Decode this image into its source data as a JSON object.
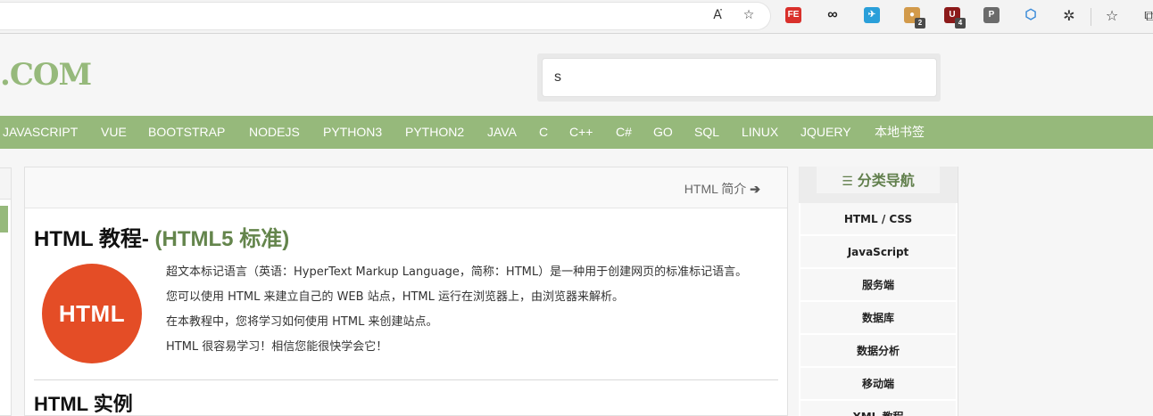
{
  "browser": {
    "read_aloud_icon": "read-aloud-icon",
    "favorite_icon": "add-favorite-icon",
    "extensions": [
      {
        "name": "fe-extension-icon",
        "label": "FE",
        "color": "#d9302b"
      },
      {
        "name": "infinity-extension-icon",
        "label": "∞",
        "color": "#222222"
      },
      {
        "name": "telegram-extension-icon",
        "label": "✈",
        "color": "#2a9fd9"
      },
      {
        "name": "cookie-extension-icon",
        "label": "●",
        "color": "#d29a4a",
        "badge": "2"
      },
      {
        "name": "ublock-extension-icon",
        "label": "U",
        "color": "#8c1a1a",
        "badge": "4"
      },
      {
        "name": "p-extension-icon",
        "label": "P",
        "color": "#6b6b6b"
      },
      {
        "name": "puzzle-blue-extension-icon",
        "label": "⬡",
        "color": "#3b8bd9"
      }
    ]
  },
  "header": {
    "logo_text": ".COM",
    "search_value": "s"
  },
  "nav": {
    "items": [
      "JAVASCRIPT",
      "VUE",
      "BOOTSTRAP",
      "NODEJS",
      "PYTHON3",
      "PYTHON2",
      "JAVA",
      "C",
      "C++",
      "C#",
      "GO",
      "SQL",
      "LINUX",
      "JQUERY",
      "本地书签"
    ]
  },
  "main": {
    "next_link": "HTML 简介",
    "title_prefix": "HTML 教程- ",
    "title_accent": "(HTML5 标准)",
    "logo_text": "HTML",
    "paragraphs": [
      "超文本标记语言（英语：HyperText Markup Language，简称：HTML）是一种用于创建网页的标准标记语言。",
      "您可以使用 HTML 来建立自己的 WEB 站点，HTML 运行在浏览器上，由浏览器来解析。",
      "在本教程中，您将学习如何使用 HTML 来创建站点。",
      "HTML 很容易学习！相信您能很快学会它！"
    ],
    "section_title": "HTML 实例"
  },
  "sidebar": {
    "heading": "分类导航",
    "categories": [
      "HTML / CSS",
      "JavaScript",
      "服务端",
      "数据库",
      "数据分析",
      "移动端",
      "XML 教程"
    ]
  }
}
